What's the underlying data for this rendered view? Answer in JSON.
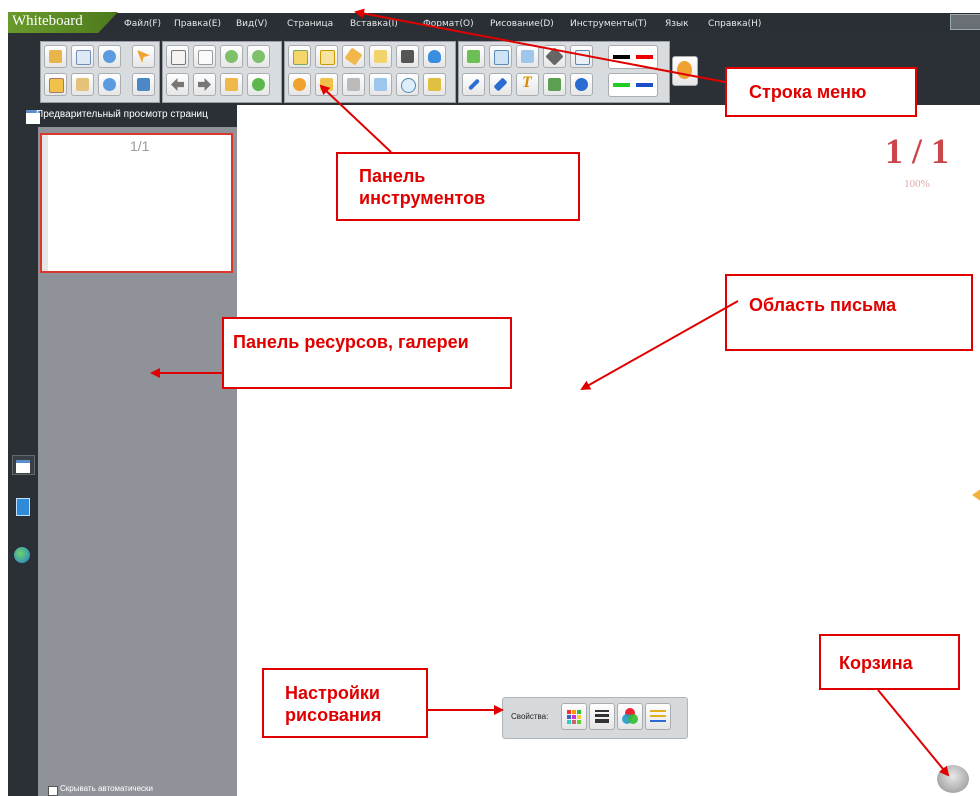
{
  "app": {
    "logo": "Whiteboard",
    "menu": [
      "Файл(F)",
      "Правка(E)",
      "Вид(V)",
      "Страница",
      "Вставка(I)",
      "Формат(O)",
      "Рисование(D)",
      "Инструменты(T)",
      "Язык",
      "Справка(H)"
    ]
  },
  "left_panel": {
    "title": "Предварительный просмотр страниц",
    "thumbnail_label": "1/1",
    "autohide_label": "Скрывать автоматически"
  },
  "canvas": {
    "page_counter": "1 / 1",
    "zoom": "100%"
  },
  "properties": {
    "label": "Свойства:"
  },
  "annotations": {
    "menu_bar": "Строка меню",
    "toolbar": "Панель инструментов",
    "writing_area": "Область письма",
    "resource_panel": "Панель ресурсов, галереи",
    "drawing_settings": "Настройки рисования",
    "trash": "Корзина"
  },
  "toolbar_icons": [
    "open-icon",
    "copy-icon",
    "undo-icon",
    "select-arrow-icon",
    "new-page-icon",
    "blank-page-icon",
    "zoom-in-icon",
    "zoom-out-icon",
    "screen-icon",
    "fit-icon",
    "highlighter-icon",
    "lamp-icon",
    "clapper-icon",
    "mic-icon",
    "link-icon",
    "screenshot-icon",
    "image-icon",
    "tools-icon",
    "grid-icon",
    "save-icon",
    "paste-icon",
    "redo-icon",
    "monitor-icon",
    "prev-page-icon",
    "next-page-icon",
    "hand-icon",
    "play-icon",
    "magnifier-icon",
    "folder-icon",
    "keyboard-icon",
    "calculator-icon",
    "clock-icon",
    "eraser-icon",
    "pen-icon",
    "double-pen-icon",
    "text-icon",
    "stamp-icon",
    "recorder-icon"
  ],
  "colors": {
    "menubar": "#2a2f36",
    "panel": "#8f9399",
    "annotation": "#e00000",
    "counter": "#c9474a"
  }
}
